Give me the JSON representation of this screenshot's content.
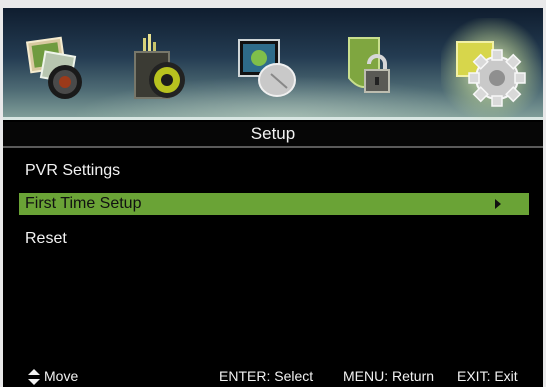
{
  "header": {
    "icons": [
      "picture-icon",
      "sound-icon",
      "channel-icon",
      "lock-icon",
      "setup-gear-icon"
    ],
    "selected_icon": "setup-gear-icon"
  },
  "title": "Setup",
  "menu": {
    "items": [
      {
        "label": "PVR Settings",
        "selected": false
      },
      {
        "label": "First Time Setup",
        "selected": true,
        "has_submenu": true
      },
      {
        "label": "Reset",
        "selected": false
      }
    ]
  },
  "footer": {
    "move": "Move",
    "select": "ENTER: Select",
    "return": "MENU: Return",
    "exit": "EXIT: Exit"
  },
  "colors": {
    "selection": "#6aa336",
    "background": "#000000",
    "text": "#f2f2f2"
  }
}
